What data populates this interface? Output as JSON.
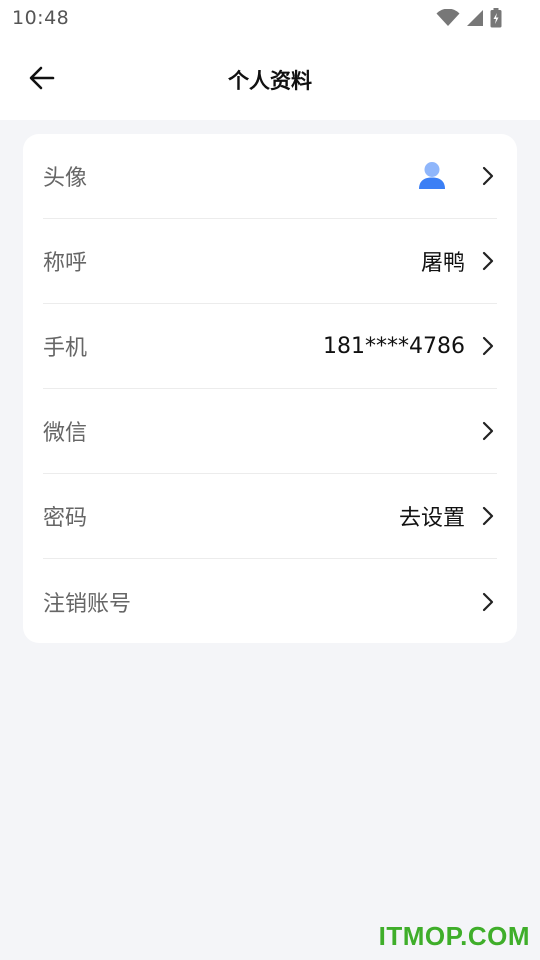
{
  "status_bar": {
    "time": "10:48",
    "icons": [
      "wifi-icon",
      "signal-icon",
      "battery-charging-icon"
    ]
  },
  "header": {
    "title": "个人资料",
    "back_icon": "arrow-left-icon"
  },
  "profile_rows": [
    {
      "label": "头像",
      "value": "",
      "icon": "user-avatar-icon"
    },
    {
      "label": "称呼",
      "value": "屠鸭"
    },
    {
      "label": "手机",
      "value": "181****4786"
    },
    {
      "label": "微信",
      "value": ""
    },
    {
      "label": "密码",
      "value": "去设置"
    },
    {
      "label": "注销账号",
      "value": ""
    }
  ],
  "colors": {
    "background": "#f4f5f8",
    "card": "#ffffff",
    "avatar_blue": "#3b7ff5",
    "watermark_green": "#3fae2a"
  },
  "watermark": "ITMOP.COM"
}
